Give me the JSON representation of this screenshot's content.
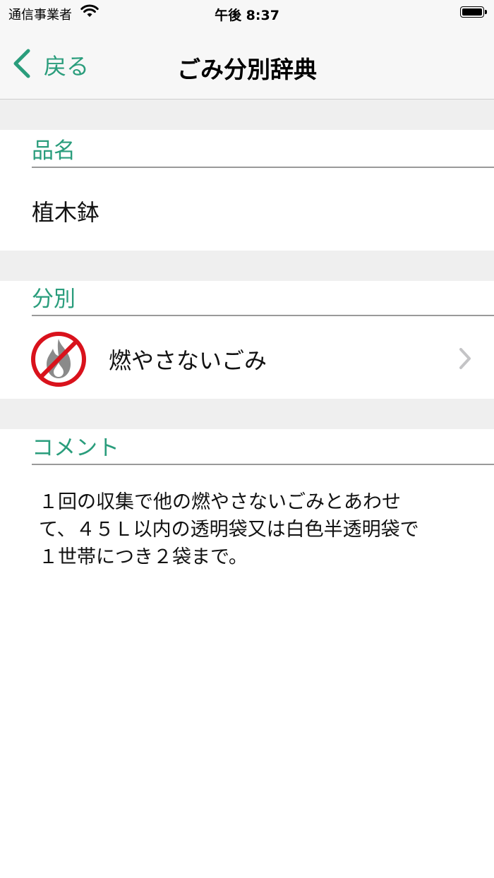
{
  "status_bar": {
    "carrier": "通信事業者",
    "time": "午後 8:37"
  },
  "nav": {
    "back_label": "戻る",
    "title": "ごみ分別辞典"
  },
  "item": {
    "header": "品名",
    "value": "植木鉢"
  },
  "category": {
    "header": "分別",
    "label": "燃やさないごみ",
    "icon": "no-burn-icon"
  },
  "comment": {
    "header": "コメント",
    "text": "１回の収集で他の燃やさないごみとあわせ\nて、４５Ｌ以内の透明袋又は白色半透明袋で\n１世帯につき２袋まで。"
  },
  "colors": {
    "accent": "#2a9d7c",
    "prohibited": "#d9121c",
    "icon_gray": "#8a8a8a"
  }
}
